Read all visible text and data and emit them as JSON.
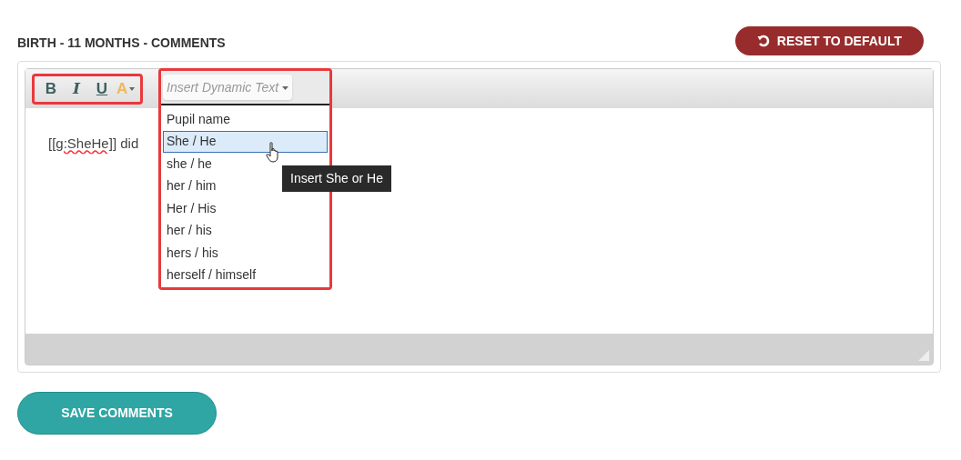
{
  "header": {
    "title": "BIRTH - 11 MONTHS - COMMENTS",
    "reset_button": "RESET TO DEFAULT"
  },
  "toolbar": {
    "format_buttons": [
      {
        "kind": "bold",
        "label": "B"
      },
      {
        "kind": "italic",
        "label": "I"
      },
      {
        "kind": "underline",
        "label": "U"
      },
      {
        "kind": "color",
        "label": "A"
      }
    ],
    "dynamic_text": {
      "label": "Insert Dynamic Text",
      "expanded": true
    }
  },
  "dropdown_items": [
    {
      "label": "Pupil name",
      "selected": false
    },
    {
      "label": "She / He",
      "selected": true
    },
    {
      "label": "she / he",
      "selected": false
    },
    {
      "label": "her / him",
      "selected": false
    },
    {
      "label": "Her / His",
      "selected": false
    },
    {
      "label": "her / his",
      "selected": false
    },
    {
      "label": "hers / his",
      "selected": false
    },
    {
      "label": "herself / himself",
      "selected": false
    }
  ],
  "tooltip": "Insert She or He",
  "editor": {
    "tag": "[[g:SheHe]]",
    "text": " did"
  },
  "save_button": "SAVE COMMENTS"
}
